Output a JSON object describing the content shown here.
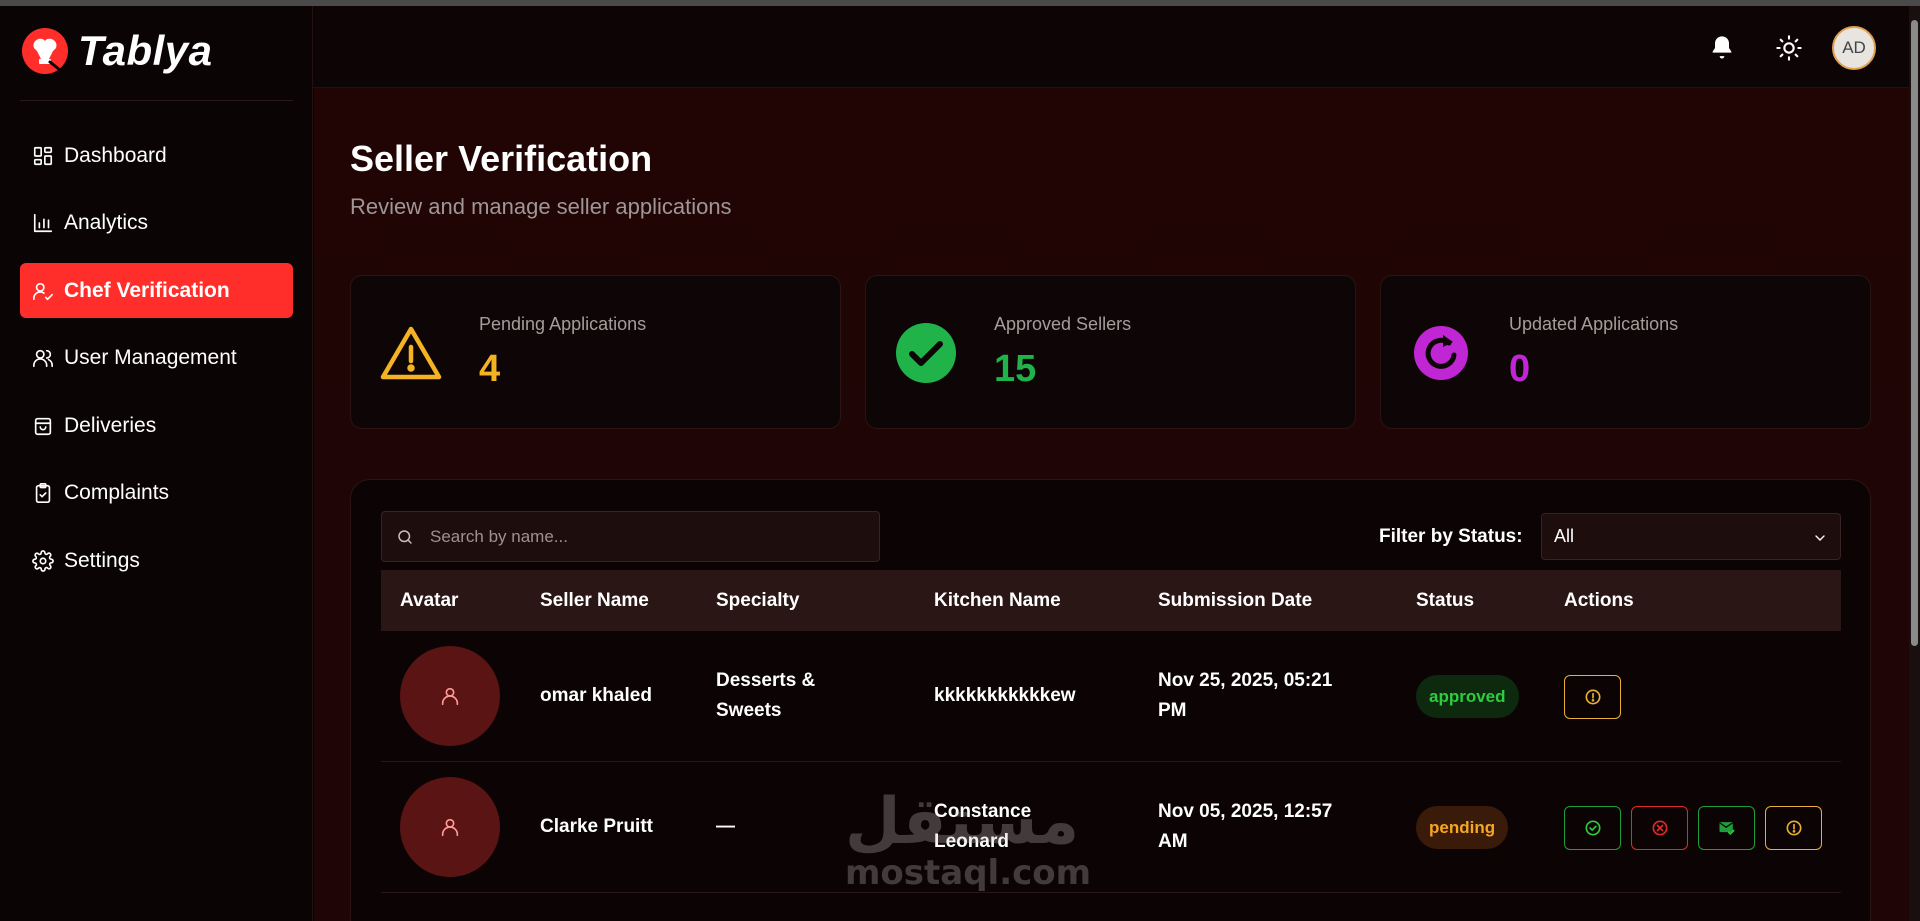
{
  "brand": {
    "name": "Tablya",
    "logo_icon": "chef-hat-logo-icon",
    "accent": "#ff2e2a"
  },
  "sidebar": {
    "items": [
      {
        "label": "Dashboard",
        "icon": "grid-icon",
        "active": false
      },
      {
        "label": "Analytics",
        "icon": "bar-chart-icon",
        "active": false
      },
      {
        "label": "Chef Verification",
        "icon": "user-check-icon",
        "active": true
      },
      {
        "label": "User Management",
        "icon": "users-icon",
        "active": false
      },
      {
        "label": "Deliveries",
        "icon": "bag-icon",
        "active": false
      },
      {
        "label": "Complaints",
        "icon": "clipboard-icon",
        "active": false
      },
      {
        "label": "Settings",
        "icon": "gear-icon",
        "active": false
      }
    ]
  },
  "header": {
    "avatar_initials": "AD",
    "bell_icon": "bell-icon",
    "theme_icon": "sun-icon"
  },
  "page": {
    "title": "Seller Verification",
    "subtitle": "Review and manage seller applications"
  },
  "stats": [
    {
      "label": "Pending Applications",
      "value": "4",
      "color": "#f5b323",
      "icon": "warning-triangle-icon"
    },
    {
      "label": "Approved Sellers",
      "value": "15",
      "color": "#1fb34a",
      "icon": "check-circle-icon"
    },
    {
      "label": "Updated Applications",
      "value": "0",
      "color": "#c026d3",
      "icon": "refresh-circle-icon"
    }
  ],
  "search": {
    "placeholder": "Search by name..."
  },
  "filter": {
    "label": "Filter by Status:",
    "selected": "All"
  },
  "table": {
    "columns": [
      "Avatar",
      "Seller Name",
      "Specialty",
      "Kitchen Name",
      "Submission Date",
      "Status",
      "Actions"
    ],
    "rows": [
      {
        "name": "omar khaled",
        "specialty_line1": "Desserts &",
        "specialty_line2": "Sweets",
        "kitchen_line1": "kkkkkkkkkkkew",
        "kitchen_line2": "",
        "date_line1": "Nov 25, 2025, 05:21",
        "date_line2": "PM",
        "status": "approved"
      },
      {
        "name": "Clarke Pruitt",
        "specialty_line1": "—",
        "specialty_line2": "",
        "kitchen_line1": "Constance",
        "kitchen_line2": "Leonard",
        "date_line1": "Nov 05, 2025, 12:57",
        "date_line2": "AM",
        "status": "pending"
      }
    ]
  },
  "watermark": {
    "arabic": "مستقل",
    "latin": "mostaql.com"
  }
}
